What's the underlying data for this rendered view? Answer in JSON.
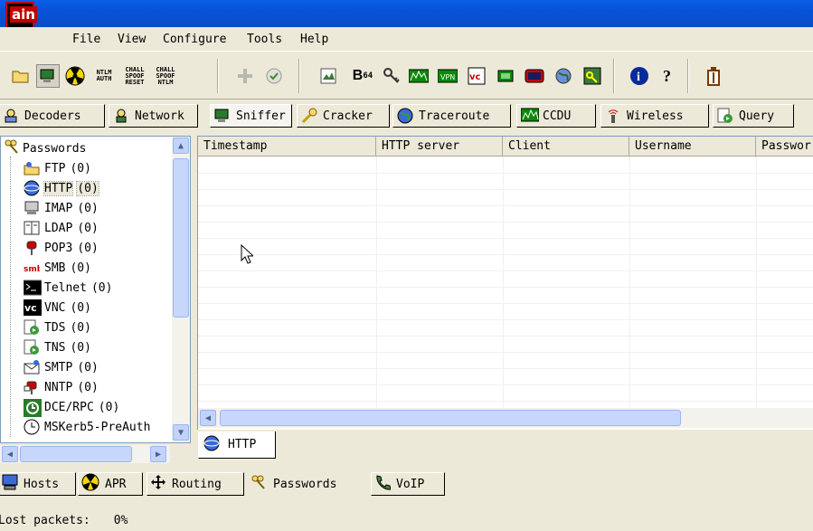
{
  "app": {
    "icon_text": "ain"
  },
  "menu": [
    "File",
    "View",
    "Configure",
    "Tools",
    "Help"
  ],
  "toolbar": {
    "ntlm_auth": [
      "NTLM",
      "AUTH"
    ],
    "chall_spoof_reset": [
      "CHALL",
      "SPOOF",
      "RESET"
    ],
    "chall_spoof_ntlm": [
      "CHALL",
      "SPOOF",
      "NTLM"
    ],
    "b64_label": "B",
    "b64_sub": "64"
  },
  "top_tabs": [
    {
      "label": "Decoders"
    },
    {
      "label": "Network"
    },
    {
      "label": "Sniffer"
    },
    {
      "label": "Cracker"
    },
    {
      "label": "Traceroute"
    },
    {
      "label": "CCDU"
    },
    {
      "label": "Wireless"
    },
    {
      "label": "Query"
    }
  ],
  "tree": {
    "root": "Passwords",
    "items": [
      {
        "label": "FTP",
        "count": "(0)"
      },
      {
        "label": "HTTP",
        "count": "(0)"
      },
      {
        "label": "IMAP",
        "count": "(0)"
      },
      {
        "label": "LDAP",
        "count": "(0)"
      },
      {
        "label": "POP3",
        "count": "(0)"
      },
      {
        "label": "SMB",
        "count": "(0)"
      },
      {
        "label": "Telnet",
        "count": "(0)"
      },
      {
        "label": "VNC",
        "count": "(0)"
      },
      {
        "label": "TDS",
        "count": "(0)"
      },
      {
        "label": "TNS",
        "count": "(0)"
      },
      {
        "label": "SMTP",
        "count": "(0)"
      },
      {
        "label": "NNTP",
        "count": "(0)"
      },
      {
        "label": "DCE/RPC",
        "count": "(0)"
      },
      {
        "label": "MSKerb5-PreAuth",
        "count": ""
      }
    ],
    "selected_index": 1
  },
  "table": {
    "columns": [
      "Timestamp",
      "HTTP server",
      "Client",
      "Username",
      "Passwor"
    ]
  },
  "sub_tab": {
    "label": "HTTP"
  },
  "bottom_tabs": [
    {
      "label": "Hosts"
    },
    {
      "label": "APR"
    },
    {
      "label": "Routing"
    },
    {
      "label": "Passwords"
    },
    {
      "label": "VoIP"
    }
  ],
  "status": {
    "lost_packets_label": "Lost packets:",
    "lost_packets_value": "0%"
  },
  "colors": {
    "titlebar": "#0753d6",
    "window_bg": "#ECE9D8",
    "selected_bg": "#ECE9D8"
  }
}
